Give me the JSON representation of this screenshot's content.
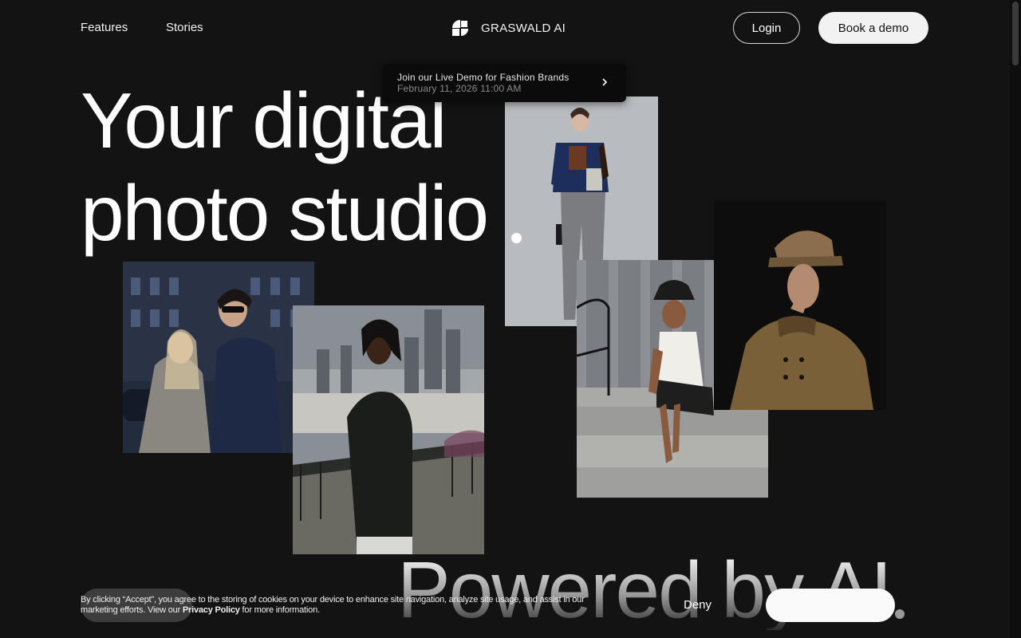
{
  "nav": {
    "features": "Features",
    "stories": "Stories",
    "brand": "GRASWALD AI",
    "login": "Login",
    "book_demo": "Book a demo"
  },
  "banner": {
    "title": "Join our Live Demo for Fashion Brands",
    "date": "February 11, 2026 11:00 AM"
  },
  "hero": {
    "line1": "Your digital",
    "line2": "photo studio"
  },
  "powered": "Powered by AI",
  "cookie": {
    "prefix": "By clicking “Accept”, you agree to the storing of cookies on your device to enhance site navigation, analyze site usage, and assist in our marketing efforts. View our ",
    "link": "Privacy Policy",
    "suffix": " for more information.",
    "deny": "Deny"
  },
  "icons": {
    "logo": "graswald-logo-icon",
    "arrow": "chevron-right-icon"
  }
}
